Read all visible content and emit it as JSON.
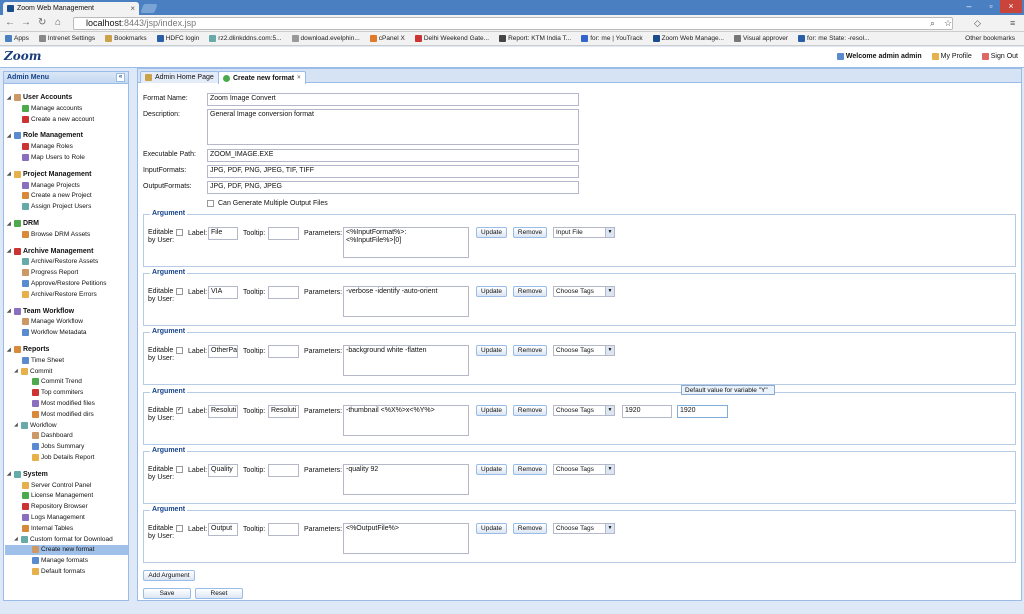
{
  "browser": {
    "tab_title": "Zoom Web Management",
    "url_host": "localhost",
    "url_path": ":8443/jsp/index.jsp",
    "bookmarks": [
      "Apps",
      "Intrenet Settings",
      "Bookmarks",
      "HDFC login",
      "rz2.dlinkddns.com:5...",
      "download.evelphin...",
      "cPanel X",
      "Delhi Weekend Gate...",
      "Report: KTM India T...",
      "for: me | YouTrack",
      "Zoom Web Manage...",
      "Visual approver",
      "for: me State: -resol..."
    ],
    "other_bookmarks": "Other bookmarks"
  },
  "app": {
    "logo": "Zoom",
    "welcome": "Welcome admin admin",
    "my_profile": "My Profile",
    "sign_out": "Sign Out"
  },
  "sidebar": {
    "title": "Admin Menu",
    "collapse": "«",
    "groups": [
      {
        "label": "User Accounts",
        "items": [
          "Manage accounts",
          "Create a new account"
        ]
      },
      {
        "label": "Role Management",
        "items": [
          "Manage Roles",
          "Map Users to Role"
        ]
      },
      {
        "label": "Project Management",
        "items": [
          "Manage Projects",
          "Create a new Project",
          "Assign Project Users"
        ]
      },
      {
        "label": "DRM",
        "items": [
          "Browse DRM Assets"
        ]
      },
      {
        "label": "Archive Management",
        "items": [
          "Archive/Restore Assets",
          "Progress Report",
          "Approve/Restore Petitions",
          "Archive/Restore Errors"
        ]
      },
      {
        "label": "Team Workflow",
        "items": [
          "Manage Workflow",
          "Workflow Metadata"
        ]
      },
      {
        "label": "Reports",
        "items": [
          "Time Sheet",
          "Commit",
          "Commit Trend",
          "Top commiters",
          "Most modified files",
          "Most modified dirs",
          "Workflow",
          "Dashboard",
          "Jobs Summary",
          "Job Details Report"
        ]
      },
      {
        "label": "System",
        "items": [
          "Server Control Panel",
          "License Management",
          "Repository Browser",
          "Logs Management",
          "Internal Tables",
          "Custom format for Download",
          "Create new format",
          "Manage formats",
          "Default formats"
        ]
      }
    ]
  },
  "tabs": [
    "Admin Home Page",
    "Create new format"
  ],
  "form": {
    "format_name_label": "Format Name:",
    "format_name": "Zoom Image Convert",
    "description_label": "Description:",
    "description": "General Image conversion format",
    "exec_label": "Executable Path:",
    "exec": "ZOOM_IMAGE.EXE",
    "input_label": "InputFormats:",
    "input": "JPG, PDF, PNG, JPEG, TIF, TIFF",
    "output_label": "OutputFormats:",
    "output": "JPG, PDF, PNG, JPEG",
    "multi_label": "Can Generate Multiple Output Files"
  },
  "argument_labels": {
    "title": "Argument",
    "editable": "Editable",
    "by_user": "by User:",
    "label": "Label:",
    "tooltip": "Tooltip:",
    "parameters": "Parameters:",
    "update": "Update",
    "remove": "Remove"
  },
  "arguments": [
    {
      "checked": false,
      "label": "File",
      "tooltip": "",
      "p1": "<%InputFormat%>:",
      "p2": "<%InputFile%>[0]",
      "select": "Input File"
    },
    {
      "checked": false,
      "label": "VIA",
      "tooltip": "",
      "p1": "-verbose -identify -auto-orient",
      "p2": "",
      "select": "Choose Tags"
    },
    {
      "checked": false,
      "label": "OtherPa",
      "tooltip": "",
      "p1": "-background white -flatten",
      "p2": "",
      "select": "Choose Tags"
    },
    {
      "checked": true,
      "label": "Resoluti",
      "tooltip": "Resoluti",
      "p1": "-thumbnail <%X%>x<%Y%>",
      "p2": "",
      "select": "Choose Tags",
      "x": "1920",
      "y": "1920"
    },
    {
      "checked": false,
      "label": "Quality",
      "tooltip": "",
      "p1": "-quality 92",
      "p2": "",
      "select": "Choose Tags"
    },
    {
      "checked": false,
      "label": "Output",
      "tooltip": "",
      "p1": "<%OutputFile%>",
      "p2": "",
      "select": "Choose Tags"
    }
  ],
  "tooltip_popup": "Default value for variable \"Y\"",
  "buttons": {
    "add": "Add Argument",
    "save": "Save",
    "reset": "Reset"
  }
}
